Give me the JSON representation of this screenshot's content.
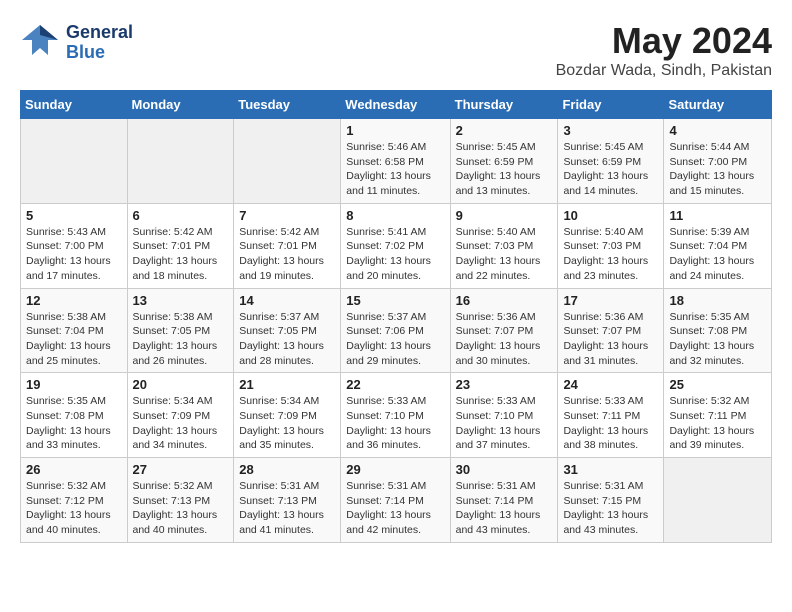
{
  "header": {
    "logo_general": "General",
    "logo_blue": "Blue",
    "month_title": "May 2024",
    "location": "Bozdar Wada, Sindh, Pakistan"
  },
  "weekdays": [
    "Sunday",
    "Monday",
    "Tuesday",
    "Wednesday",
    "Thursday",
    "Friday",
    "Saturday"
  ],
  "weeks": [
    [
      {
        "num": "",
        "info": ""
      },
      {
        "num": "",
        "info": ""
      },
      {
        "num": "",
        "info": ""
      },
      {
        "num": "1",
        "info": "Sunrise: 5:46 AM\nSunset: 6:58 PM\nDaylight: 13 hours\nand 11 minutes."
      },
      {
        "num": "2",
        "info": "Sunrise: 5:45 AM\nSunset: 6:59 PM\nDaylight: 13 hours\nand 13 minutes."
      },
      {
        "num": "3",
        "info": "Sunrise: 5:45 AM\nSunset: 6:59 PM\nDaylight: 13 hours\nand 14 minutes."
      },
      {
        "num": "4",
        "info": "Sunrise: 5:44 AM\nSunset: 7:00 PM\nDaylight: 13 hours\nand 15 minutes."
      }
    ],
    [
      {
        "num": "5",
        "info": "Sunrise: 5:43 AM\nSunset: 7:00 PM\nDaylight: 13 hours\nand 17 minutes."
      },
      {
        "num": "6",
        "info": "Sunrise: 5:42 AM\nSunset: 7:01 PM\nDaylight: 13 hours\nand 18 minutes."
      },
      {
        "num": "7",
        "info": "Sunrise: 5:42 AM\nSunset: 7:01 PM\nDaylight: 13 hours\nand 19 minutes."
      },
      {
        "num": "8",
        "info": "Sunrise: 5:41 AM\nSunset: 7:02 PM\nDaylight: 13 hours\nand 20 minutes."
      },
      {
        "num": "9",
        "info": "Sunrise: 5:40 AM\nSunset: 7:03 PM\nDaylight: 13 hours\nand 22 minutes."
      },
      {
        "num": "10",
        "info": "Sunrise: 5:40 AM\nSunset: 7:03 PM\nDaylight: 13 hours\nand 23 minutes."
      },
      {
        "num": "11",
        "info": "Sunrise: 5:39 AM\nSunset: 7:04 PM\nDaylight: 13 hours\nand 24 minutes."
      }
    ],
    [
      {
        "num": "12",
        "info": "Sunrise: 5:38 AM\nSunset: 7:04 PM\nDaylight: 13 hours\nand 25 minutes."
      },
      {
        "num": "13",
        "info": "Sunrise: 5:38 AM\nSunset: 7:05 PM\nDaylight: 13 hours\nand 26 minutes."
      },
      {
        "num": "14",
        "info": "Sunrise: 5:37 AM\nSunset: 7:05 PM\nDaylight: 13 hours\nand 28 minutes."
      },
      {
        "num": "15",
        "info": "Sunrise: 5:37 AM\nSunset: 7:06 PM\nDaylight: 13 hours\nand 29 minutes."
      },
      {
        "num": "16",
        "info": "Sunrise: 5:36 AM\nSunset: 7:07 PM\nDaylight: 13 hours\nand 30 minutes."
      },
      {
        "num": "17",
        "info": "Sunrise: 5:36 AM\nSunset: 7:07 PM\nDaylight: 13 hours\nand 31 minutes."
      },
      {
        "num": "18",
        "info": "Sunrise: 5:35 AM\nSunset: 7:08 PM\nDaylight: 13 hours\nand 32 minutes."
      }
    ],
    [
      {
        "num": "19",
        "info": "Sunrise: 5:35 AM\nSunset: 7:08 PM\nDaylight: 13 hours\nand 33 minutes."
      },
      {
        "num": "20",
        "info": "Sunrise: 5:34 AM\nSunset: 7:09 PM\nDaylight: 13 hours\nand 34 minutes."
      },
      {
        "num": "21",
        "info": "Sunrise: 5:34 AM\nSunset: 7:09 PM\nDaylight: 13 hours\nand 35 minutes."
      },
      {
        "num": "22",
        "info": "Sunrise: 5:33 AM\nSunset: 7:10 PM\nDaylight: 13 hours\nand 36 minutes."
      },
      {
        "num": "23",
        "info": "Sunrise: 5:33 AM\nSunset: 7:10 PM\nDaylight: 13 hours\nand 37 minutes."
      },
      {
        "num": "24",
        "info": "Sunrise: 5:33 AM\nSunset: 7:11 PM\nDaylight: 13 hours\nand 38 minutes."
      },
      {
        "num": "25",
        "info": "Sunrise: 5:32 AM\nSunset: 7:11 PM\nDaylight: 13 hours\nand 39 minutes."
      }
    ],
    [
      {
        "num": "26",
        "info": "Sunrise: 5:32 AM\nSunset: 7:12 PM\nDaylight: 13 hours\nand 40 minutes."
      },
      {
        "num": "27",
        "info": "Sunrise: 5:32 AM\nSunset: 7:13 PM\nDaylight: 13 hours\nand 40 minutes."
      },
      {
        "num": "28",
        "info": "Sunrise: 5:31 AM\nSunset: 7:13 PM\nDaylight: 13 hours\nand 41 minutes."
      },
      {
        "num": "29",
        "info": "Sunrise: 5:31 AM\nSunset: 7:14 PM\nDaylight: 13 hours\nand 42 minutes."
      },
      {
        "num": "30",
        "info": "Sunrise: 5:31 AM\nSunset: 7:14 PM\nDaylight: 13 hours\nand 43 minutes."
      },
      {
        "num": "31",
        "info": "Sunrise: 5:31 AM\nSunset: 7:15 PM\nDaylight: 13 hours\nand 43 minutes."
      },
      {
        "num": "",
        "info": ""
      }
    ]
  ]
}
